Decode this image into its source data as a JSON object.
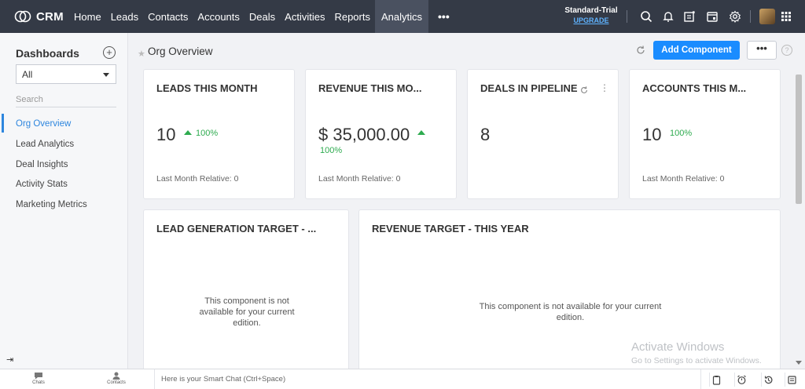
{
  "app": {
    "logo_text": "CRM"
  },
  "nav": {
    "items": [
      "Home",
      "Leads",
      "Contacts",
      "Accounts",
      "Deals",
      "Activities",
      "Reports",
      "Analytics"
    ],
    "active": "Analytics",
    "more": "•••"
  },
  "plan": {
    "name": "Standard-Trial",
    "upgrade": "UPGRADE"
  },
  "sidebar": {
    "title": "Dashboards",
    "add": "+",
    "filter_value": "All",
    "search_placeholder": "Search",
    "items": [
      "Org Overview",
      "Lead Analytics",
      "Deal Insights",
      "Activity Stats",
      "Marketing Metrics"
    ],
    "active_index": 0,
    "collapse": "⇥"
  },
  "header": {
    "title": "Org Overview",
    "add_button": "Add Component",
    "more_button": "•••",
    "help": "?"
  },
  "cards": {
    "leads": {
      "title": "LEADS THIS MONTH",
      "value": "10",
      "change": "100%",
      "relative": "Last Month Relative: 0"
    },
    "revenue": {
      "title": "REVENUE THIS MO...",
      "value": "$ 35,000.00",
      "change": "100%",
      "relative": "Last Month Relative: 0"
    },
    "deals": {
      "title": "DEALS IN PIPELINE",
      "value": "8"
    },
    "accounts": {
      "title": "ACCOUNTS THIS M...",
      "value": "10",
      "change": "100%",
      "relative": "Last Month Relative: 0"
    },
    "lead_target": {
      "title": "LEAD GENERATION TARGET - ...",
      "message_line1": "This component is not",
      "message_line2": "available for your current",
      "message_line3": "edition."
    },
    "revenue_target": {
      "title": "REVENUE TARGET - THIS YEAR",
      "message_line1": "This component is not available for your current",
      "message_line2": "edition."
    }
  },
  "watermark": {
    "line1": "Activate Windows",
    "line2": "Go to Settings to activate Windows."
  },
  "bottombar": {
    "chats": "Chats",
    "contacts": "Contacts",
    "smartchat_placeholder": "Here is your Smart Chat (Ctrl+Space)"
  },
  "colors": {
    "nav_bg": "#343a46",
    "accent": "#1a8cff",
    "positive": "#2eab4f"
  }
}
